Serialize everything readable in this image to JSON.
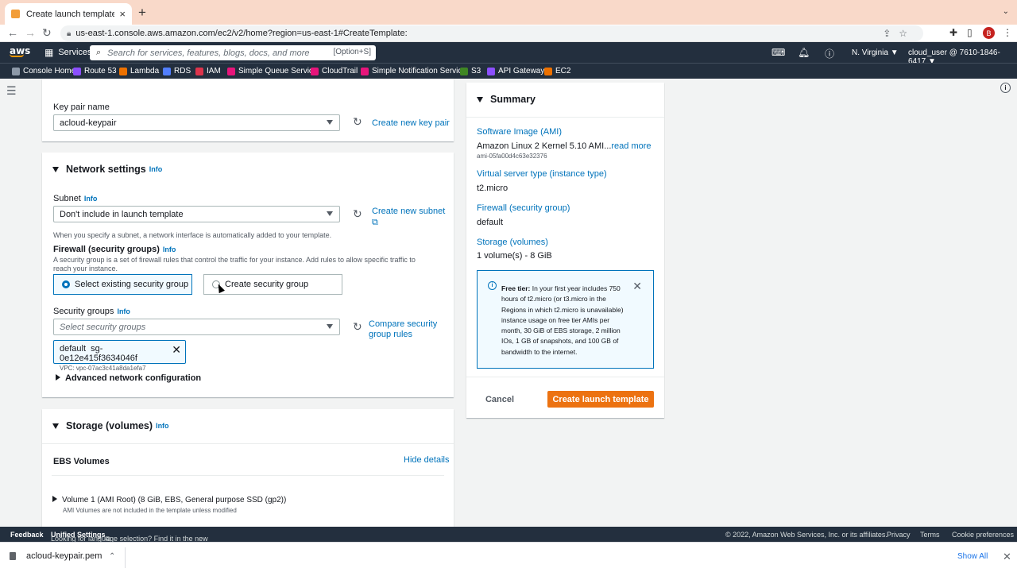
{
  "browser": {
    "tab_title": "Create launch template | EC2 M",
    "url": "us-east-1.console.aws.amazon.com/ec2/v2/home?region=us-east-1#CreateTemplate:",
    "avatar_letter": "B"
  },
  "aws_nav": {
    "services_label": "Services",
    "search_placeholder": "Search for services, features, blogs, docs, and more",
    "search_shortcut": "[Option+S]",
    "region": "N. Virginia ▼",
    "account": "cloud_user @ 7610-1846-6417 ▼"
  },
  "favorites": [
    {
      "label": "Console Home",
      "color": "#8d99a8"
    },
    {
      "label": "Route 53",
      "color": "#8c4fff"
    },
    {
      "label": "Lambda",
      "color": "#ed7100"
    },
    {
      "label": "RDS",
      "color": "#527fff"
    },
    {
      "label": "IAM",
      "color": "#dd344c"
    },
    {
      "label": "Simple Queue Service",
      "color": "#e7157b"
    },
    {
      "label": "CloudTrail",
      "color": "#e7157b"
    },
    {
      "label": "Simple Notification Service",
      "color": "#e7157b"
    },
    {
      "label": "S3",
      "color": "#3f8624"
    },
    {
      "label": "API Gateway",
      "color": "#8c4fff"
    },
    {
      "label": "EC2",
      "color": "#ed7100"
    }
  ],
  "keypair": {
    "label": "Key pair name",
    "value": "acloud-keypair",
    "create_link": "Create new key pair"
  },
  "network": {
    "title": "Network settings",
    "info": "Info",
    "subnet_label": "Subnet",
    "subnet_value": "Don't include in launch template",
    "create_subnet": "Create new subnet",
    "subnet_help": "When you specify a subnet, a network interface is automatically added to your template.",
    "firewall_label": "Firewall (security groups)",
    "firewall_help": "A security group is a set of firewall rules that control the traffic for your instance. Add rules to allow specific traffic to reach your instance.",
    "option_existing": "Select existing security group",
    "option_create": "Create security group",
    "sg_label": "Security groups",
    "sg_placeholder": "Select security groups",
    "compare_rules": "Compare security group rules",
    "token_name": "default",
    "token_id": "sg-0e12e415f3634046f",
    "token_vpc": "VPC: vpc-07ac3c41a8da1efa7",
    "advanced": "Advanced network configuration"
  },
  "storage": {
    "title": "Storage (volumes)",
    "info": "Info",
    "ebs_title": "EBS Volumes",
    "hide_details": "Hide details",
    "volume_title": "Volume 1 (AMI Root) (8 GiB, EBS, General purpose SSD (gp2))",
    "volume_note": "AMI Volumes are not included in the template unless modified"
  },
  "summary": {
    "title": "Summary",
    "ami_label": "Software Image (AMI)",
    "ami_value": "Amazon Linux 2 Kernel 5.10 AMI...",
    "read_more": "read more",
    "ami_id": "ami-05fa00d4c63e32376",
    "type_label": "Virtual server type (instance type)",
    "type_value": "t2.micro",
    "firewall_label": "Firewall (security group)",
    "firewall_value": "default",
    "storage_label": "Storage (volumes)",
    "storage_value": "1 volume(s) - 8 GiB",
    "free_tier_bold": "Free tier:",
    "free_tier_text": " In your first year includes 750 hours of t2.micro (or t3.micro in the Regions in which t2.micro is unavailable) instance usage on free tier AMIs per month, 30 GiB of EBS storage, 2 million IOs, 1 GB of snapshots, and 100 GB of bandwidth to the internet.",
    "cancel": "Cancel",
    "create": "Create launch template"
  },
  "footer": {
    "feedback": "Feedback",
    "lang_text": "Looking for language selection? Find it in the new",
    "unified": "Unified Settings",
    "copyright": "© 2022, Amazon Web Services, Inc. or its affiliates.",
    "privacy": "Privacy",
    "terms": "Terms",
    "cookies": "Cookie preferences"
  },
  "downloads": {
    "file": "acloud-keypair.pem",
    "show_all": "Show All"
  }
}
